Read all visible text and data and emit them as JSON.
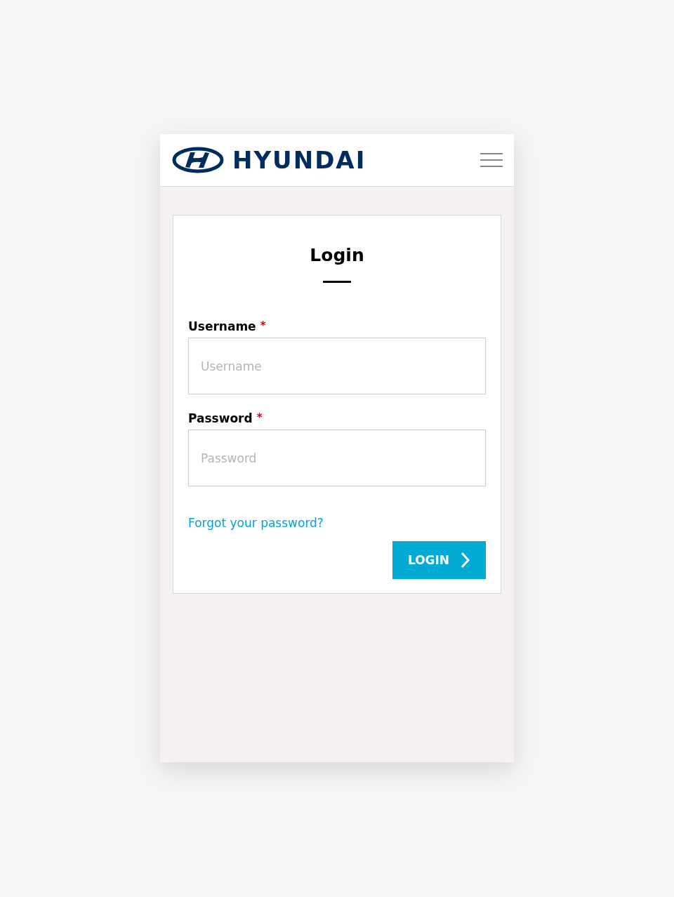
{
  "header": {
    "logo": "HYUNDAI"
  },
  "login": {
    "title": "Login",
    "fields": [
      {
        "label": "Username",
        "required_mark": "*",
        "placeholder": "Username"
      },
      {
        "label": "Password",
        "required_mark": "*",
        "placeholder": "Password"
      }
    ],
    "forgot_link": "Forgot your password?",
    "button": "LOGIN"
  }
}
